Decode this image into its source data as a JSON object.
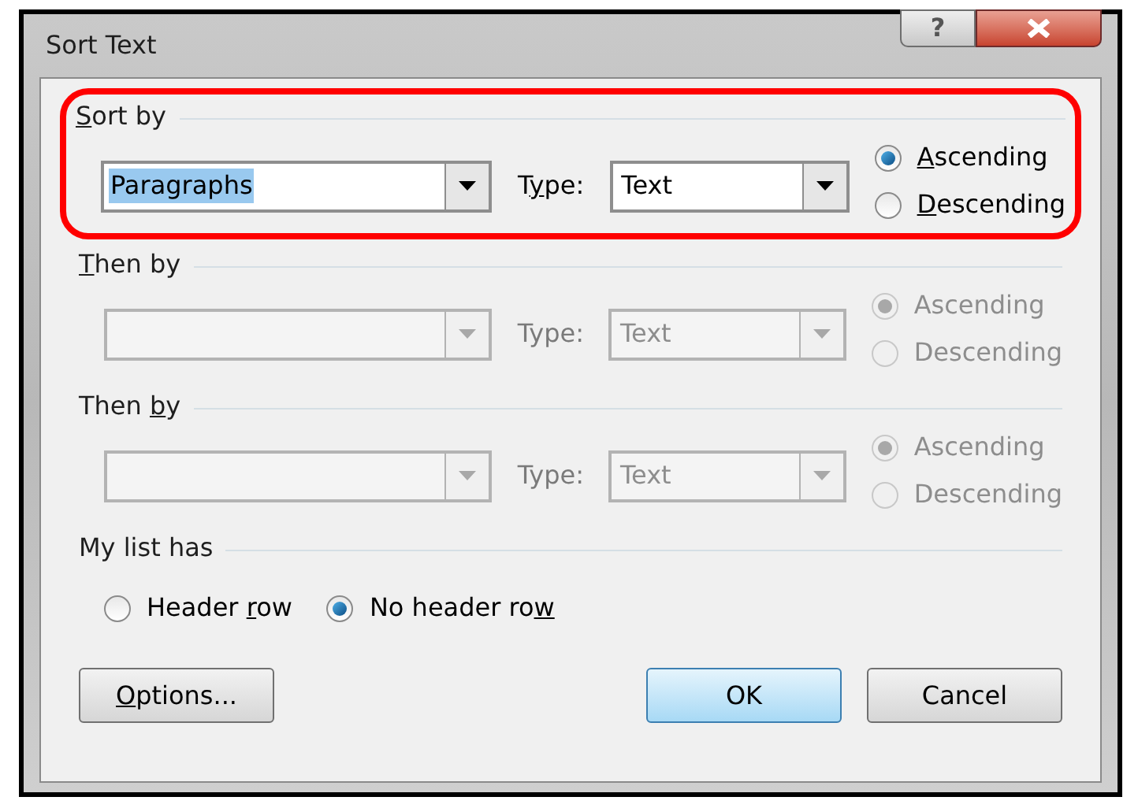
{
  "window": {
    "title": "Sort Text",
    "help_button": "?"
  },
  "sections": [
    {
      "label": {
        "key": "S",
        "post": "ort by"
      },
      "highlighted": true,
      "disabled": false,
      "field": {
        "value": "Paragraphs",
        "text_selected": true
      },
      "type_label": {
        "pre": "T",
        "key": "y",
        "post": "pe:"
      },
      "type_value": "Text",
      "orders": [
        {
          "label": {
            "key": "A",
            "post": "scending"
          },
          "selected": true
        },
        {
          "label": {
            "key": "D",
            "post": "escending"
          },
          "selected": false
        }
      ]
    },
    {
      "label": {
        "key": "T",
        "post": "hen by"
      },
      "highlighted": false,
      "disabled": true,
      "type_label": "Type:",
      "type_value": "Text",
      "orders": [
        {
          "label": "Ascending",
          "selected": true
        },
        {
          "label": "Descending",
          "selected": false
        }
      ]
    },
    {
      "label": {
        "pre": "Then ",
        "key": "b",
        "post": "y"
      },
      "highlighted": false,
      "disabled": true,
      "type_label": "Type:",
      "type_value": "Text",
      "orders": [
        {
          "label": "Ascending",
          "selected": true
        },
        {
          "label": "Descending",
          "selected": false
        }
      ]
    }
  ],
  "list_has": {
    "label": "My list has",
    "options": [
      {
        "label": {
          "pre": "Header ",
          "key": "r",
          "post": "ow"
        },
        "selected": false
      },
      {
        "label": {
          "pre": "No header ro",
          "key": "w"
        },
        "selected": true
      }
    ]
  },
  "buttons": [
    {
      "label": {
        "key": "O",
        "post": "ptions..."
      },
      "default": false
    },
    {
      "label": "OK",
      "default": true
    },
    {
      "label": "Cancel",
      "default": false
    }
  ]
}
